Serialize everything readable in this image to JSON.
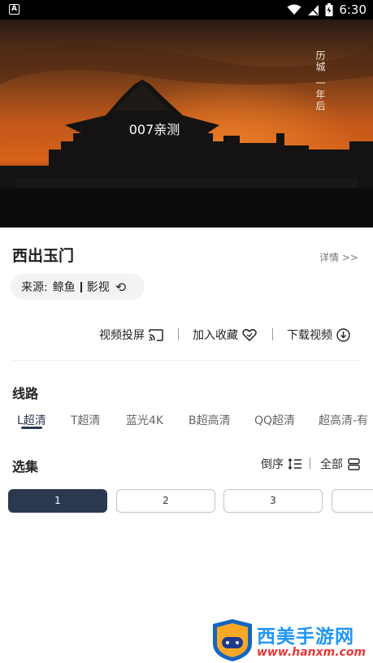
{
  "status_bar": {
    "time": "6:30"
  },
  "player": {
    "caption": "007亲测",
    "calligraphy": "历城 一年后"
  },
  "title": "西出玉门",
  "detail_link": "详情 >>",
  "source": {
    "label": "来源:",
    "name_a": "鲸鱼",
    "name_b": "影视"
  },
  "actions": {
    "cast": "视频投屏",
    "favorite": "加入收藏",
    "download": "下载视频"
  },
  "routes": {
    "heading": "线路",
    "items": [
      "L超清",
      "T超清",
      "蓝光4K",
      "B超高清",
      "QQ超清",
      "超高清-有"
    ],
    "active_index": 0
  },
  "episodes": {
    "heading": "选集",
    "order_label": "倒序",
    "all_label": "全部",
    "items": [
      "1",
      "2",
      "3",
      ""
    ]
  },
  "watermark": {
    "brand": "西美手游网",
    "url": "www.hanxm.com"
  }
}
